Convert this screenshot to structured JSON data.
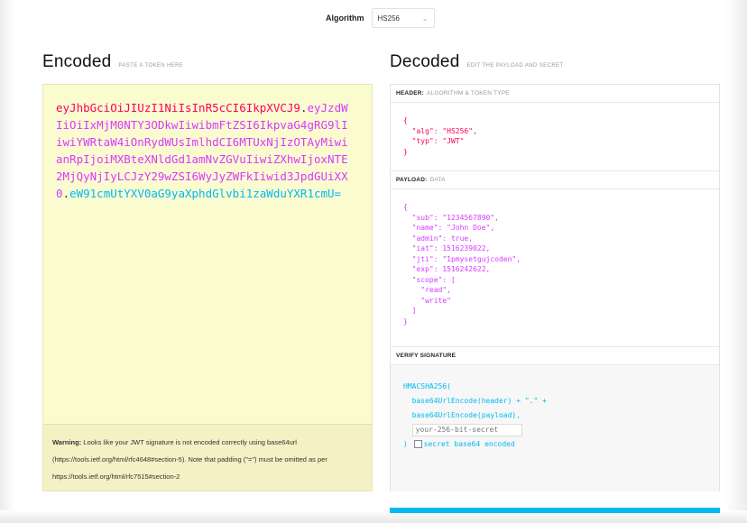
{
  "algorithm": {
    "label": "Algorithm",
    "selected": "HS256"
  },
  "encoded": {
    "title": "Encoded",
    "subtitle": "PASTE A TOKEN HERE",
    "token_header": "eyJhbGciOiJIUzI1NiIsInR5cCI6IkpXVCJ9",
    "token_payload": "eyJzdWIiOiIxMjM0NTY3ODkwIiwibmFtZSI6IkpvaG4gRG9lIiwiYWRtaW4iOnRydWUsImlhdCI6MTUxNjIzOTAyMiwianRpIjoiMXBteXNldGd1amNvZGVuIiwiZXhwIjoxNTE2MjQyNjIyLCJzY29wZSI6WyJyZWFkIiwid3JpdGUiXX0",
    "token_signature": "eW91cmUtYXV0aG9yaXphdGlvbi1zaWduYXR1cmU=",
    "dot": ".",
    "warning_strong": "Warning:",
    "warning_text": " Looks like your JWT signature is not encoded correctly using base64url (https://tools.ietf.org/html/rfc4648#section-5). Note that padding (\"=\") must be omitted as per https://tools.ietf.org/html/rfc7515#section-2"
  },
  "decoded": {
    "title": "Decoded",
    "subtitle": "EDIT THE PAYLOAD AND SECRET",
    "header_section": {
      "title": "HEADER:",
      "subtitle": "ALGORITHM & TOKEN TYPE",
      "code": "{\n  \"alg\": \"HS256\",\n  \"typ\": \"JWT\"\n}"
    },
    "payload_section": {
      "title": "PAYLOAD:",
      "subtitle": "DATA",
      "code": "{\n  \"sub\": \"1234567890\",\n  \"name\": \"John Doe\",\n  \"admin\": true,\n  \"iat\": 1516239022,\n  \"jti\": \"1pmysetgujcoden\",\n  \"exp\": 1516242622,\n  \"scope\": [\n    \"read\",\n    \"write\"\n  ]\n}"
    },
    "signature_section": {
      "title": "VERIFY SIGNATURE",
      "line1": "HMACSHA256(",
      "line2": "  base64UrlEncode(header) + \".\" +",
      "line3": "  base64UrlEncode(payload),",
      "secret_placeholder": "your-256-bit-secret",
      "close": ")",
      "checkbox_label": "secret base64 encoded"
    }
  },
  "colors": {
    "header": "#fb015b",
    "payload": "#d63aff",
    "signature": "#00b9f1"
  }
}
